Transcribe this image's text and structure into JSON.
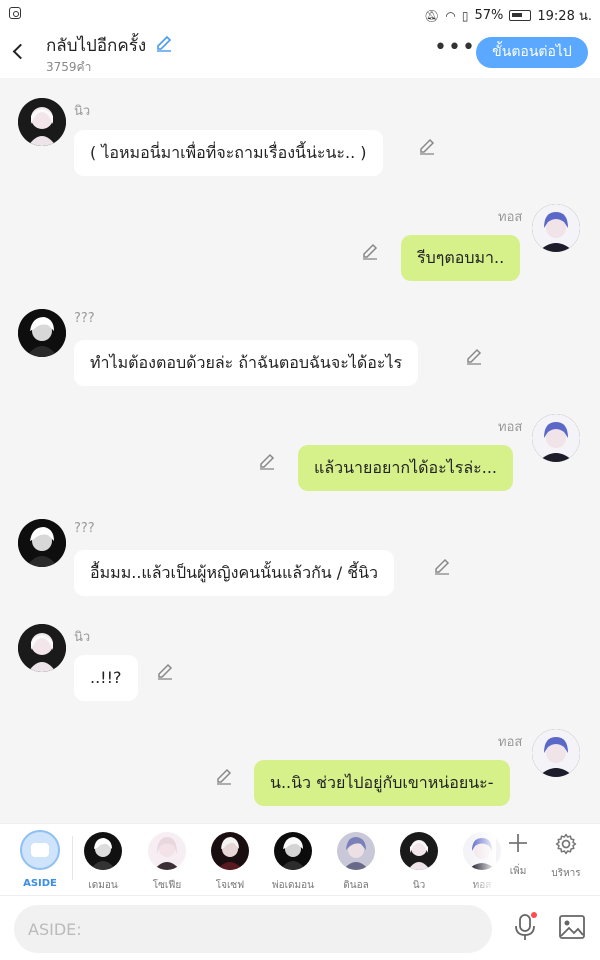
{
  "status": {
    "battery_pct": "57%",
    "time": "19:28 น."
  },
  "header": {
    "title": "กลับไปอีกครั้ง",
    "word_count": "3759คำ",
    "next_label": "ขั้นตอนต่อไป"
  },
  "messages": [
    {
      "name": "นิว",
      "text": "( ไอหมอนี่มาเพื่อที่จะถามเรื่องนี้น่ะนะ.. )"
    },
    {
      "name": "ทอส",
      "text": "รีบๆตอบมา.."
    },
    {
      "name": "???",
      "text": "ทำไมต้องตอบด้วยล่ะ ถ้าฉันตอบฉันจะได้อะไร"
    },
    {
      "name": "ทอส",
      "text": "แล้วนายอยากได้อะไรล่ะ..."
    },
    {
      "name": "???",
      "text": "อื้มมม..แล้วเป็นผู้หญิงคนนั้นแล้วกัน / ชี้นิว"
    },
    {
      "name": "นิว",
      "text": "..!!?"
    },
    {
      "name": "ทอส",
      "text": "น..นิว ช่วยไปอยู่กับเขาหน่อยนะ-"
    }
  ],
  "charbar": {
    "aside_label": "ASIDE",
    "characters": [
      "เดมอน",
      "โซเฟีย",
      "โจเซฟ",
      "พ่อเดมอน",
      "ดินอล",
      "นิว",
      "ทอส"
    ],
    "add_label": "เพิ่ม",
    "manage_label": "บริหาร"
  },
  "input": {
    "placeholder": "ASIDE:"
  }
}
